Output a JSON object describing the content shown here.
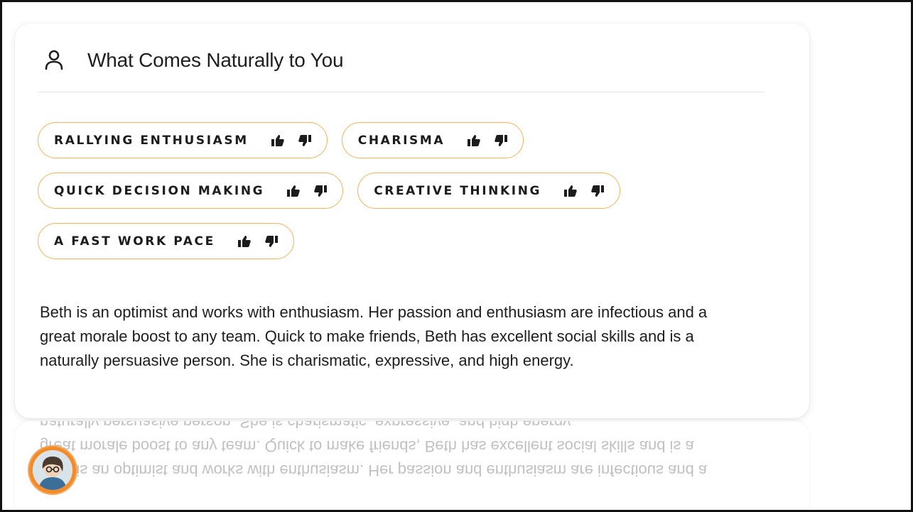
{
  "section": {
    "title": "What Comes Naturally to You",
    "icon": "user-icon"
  },
  "chips": [
    {
      "label": "RALLYING ENTHUSIASM"
    },
    {
      "label": "CHARISMA"
    },
    {
      "label": "QUICK DECISION MAKING"
    },
    {
      "label": "CREATIVE THINKING"
    },
    {
      "label": "A FAST WORK PACE"
    }
  ],
  "chip_actions": {
    "like_icon": "thumbs-up-icon",
    "dislike_icon": "thumbs-down-icon"
  },
  "description": "Beth is an optimist and works with enthusiasm. Her passion and enthusiasm are infectious and a great morale boost to any team. Quick to make friends, Beth has excellent social skills and is a naturally persuasive person. She is charismatic, expressive, and high energy.",
  "colors": {
    "chip_border": "#f3b35a",
    "avatar_ring": "#f28c2a",
    "text": "#1e1e1e"
  }
}
